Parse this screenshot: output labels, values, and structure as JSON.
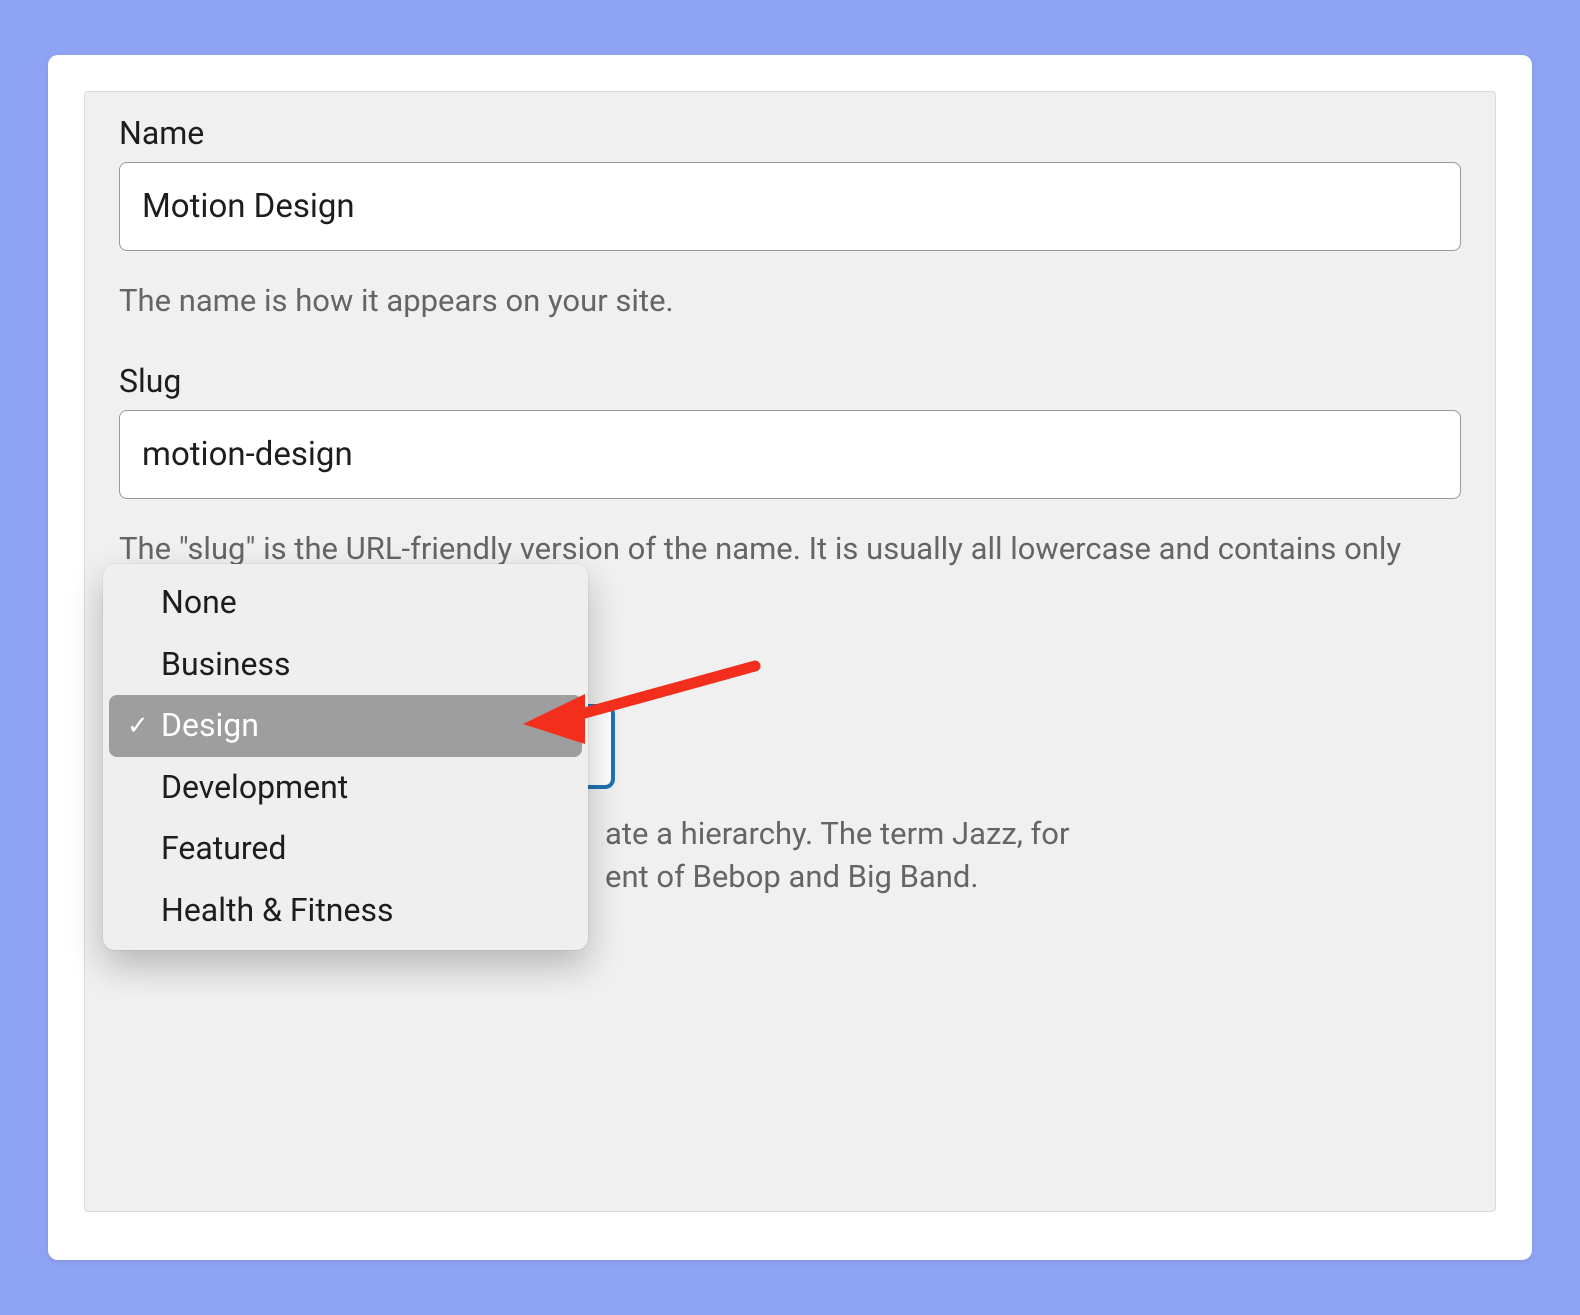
{
  "form": {
    "name": {
      "label": "Name",
      "value": "Motion Design",
      "help": "The name is how it appears on your site."
    },
    "slug": {
      "label": "Slug",
      "value": "motion-design",
      "help": "The \"slug\" is the URL-friendly version of the name. It is usually all lowercase and contains only letters, numbers, and hyphens."
    },
    "parent": {
      "help_fragment_1": "ate a hierarchy. The term Jazz, for",
      "help_fragment_2": "ent of Bebop and Big Band."
    }
  },
  "popup": {
    "items": [
      {
        "label": "None",
        "selected": false
      },
      {
        "label": "Business",
        "selected": false
      },
      {
        "label": "Design",
        "selected": true
      },
      {
        "label": "Development",
        "selected": false
      },
      {
        "label": "Featured",
        "selected": false
      },
      {
        "label": "Health & Fitness",
        "selected": false
      }
    ],
    "checkmark": "✓"
  }
}
